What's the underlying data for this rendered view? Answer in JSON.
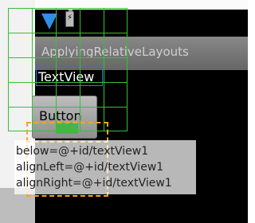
{
  "app": {
    "title": "ApplyingRelativeLayouts"
  },
  "widgets": {
    "textview_label": "TextView",
    "button_label": "Button"
  },
  "tooltip": {
    "lines": [
      "below=@+id/textView1",
      "alignLeft=@+id/textView1",
      "alignRight=@+id/textView1"
    ]
  },
  "icons": {
    "signal": "signal-icon",
    "battery": "battery-charging-icon"
  },
  "colors": {
    "selection_blue": "#2b72ff",
    "grid_green": "#35c035",
    "drop_orange": "#f2a623",
    "signal_blue": "#2f8fe6"
  }
}
